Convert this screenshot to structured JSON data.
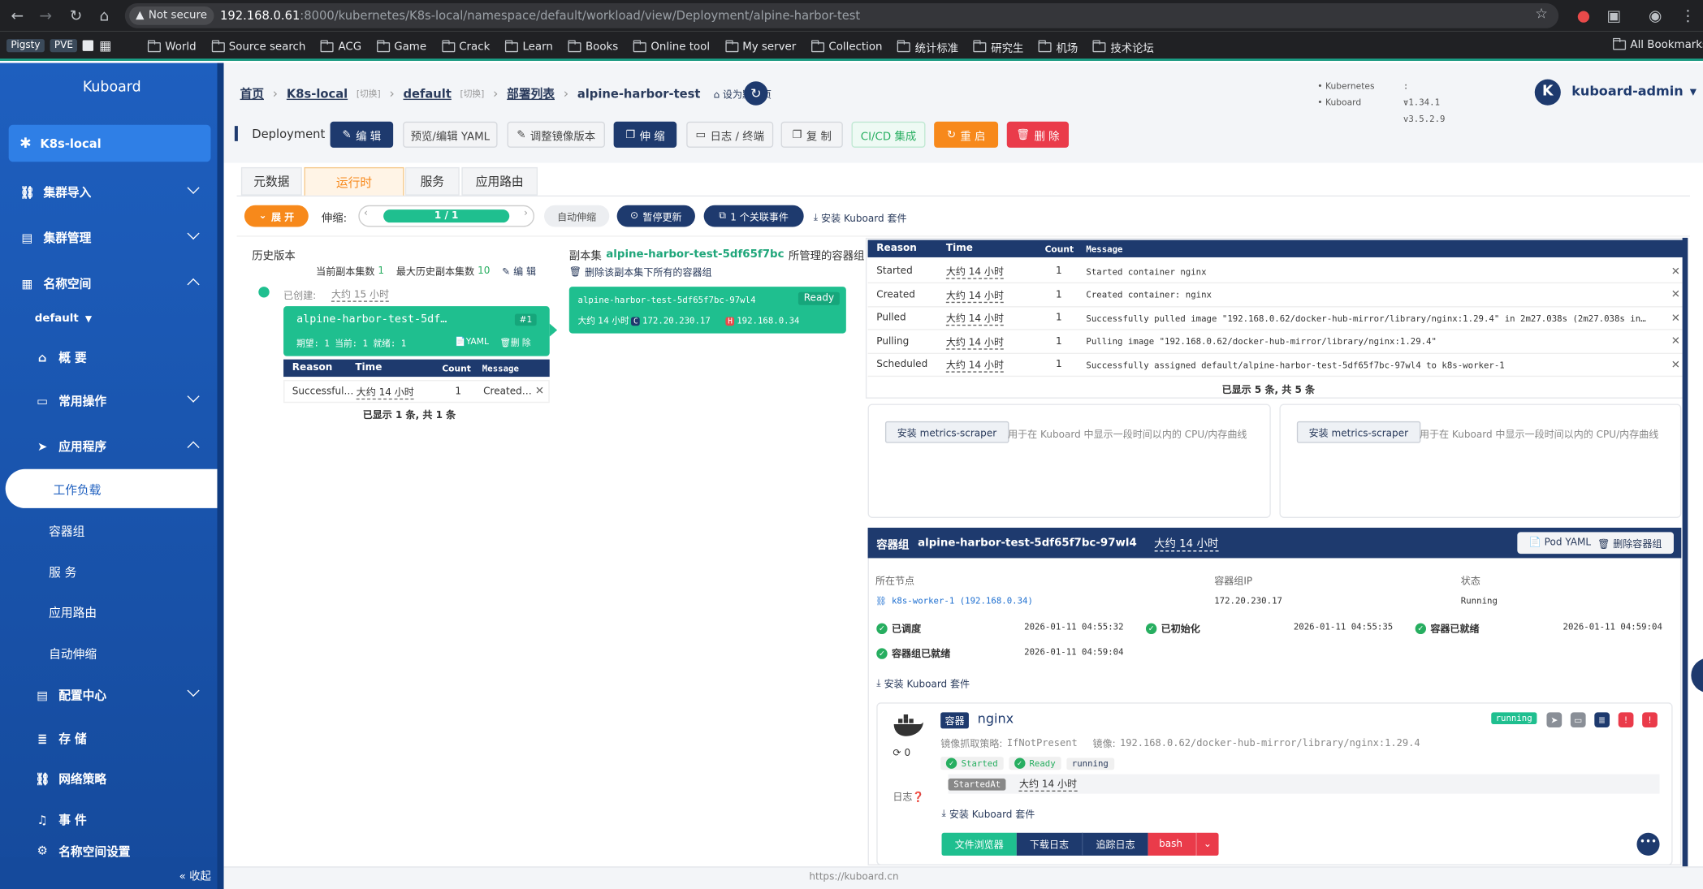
{
  "browser": {
    "not_secure": "Not secure",
    "url_host": "192.168.0.61",
    "url_rest": ":8000/kubernetes/K8s-local/namespace/default/workload/view/Deployment/alpine-harbor-test",
    "bookmarks": [
      "Pigsty",
      "PVE",
      "World",
      "Source search",
      "ACG",
      "Game",
      "Crack",
      "Learn",
      "Books",
      "Online tool",
      "My server",
      "Collection",
      "统计标准",
      "研究生",
      "机场",
      "技术论坛"
    ],
    "all_bookmarks": "All Bookmarks"
  },
  "sidebar": {
    "title": "Kuboard",
    "cluster": "K8s-local",
    "items": {
      "import": "集群导入",
      "manage": "集群管理",
      "namespace": "名称空间",
      "ns_value": "default",
      "overview": "概 要",
      "common": "常用操作",
      "apps": "应用程序",
      "workload": "工作负载",
      "pods": "容器组",
      "services": "服 务",
      "ingress": "应用路由",
      "autoscale": "自动伸缩",
      "config": "配置中心",
      "storage": "存 储",
      "netpol": "网络策略",
      "events": "事 件",
      "ns_settings": "名称空间设置"
    },
    "collapse": "« 收起"
  },
  "header": {
    "crumbs": {
      "home": "首页",
      "cluster": "K8s-local",
      "switch1": "[切换]",
      "ns": "default",
      "switch2": "[切换]",
      "list": "部署列表",
      "name": "alpine-harbor-test",
      "set_default": "设为默认页"
    },
    "versions": {
      "k8s_label": "Kubernetes",
      "k8s_ver": ": v1.34.1",
      "kb_label": "Kuboard",
      "kb_ver": ": v3.5.2.9"
    },
    "user": "kuboard-admin",
    "avatar": "K"
  },
  "toolbar": {
    "kind": "Deployment",
    "edit": "编 辑",
    "yaml": "预览/编辑 YAML",
    "image": "调整镜像版本",
    "scale": "伸 缩",
    "logs": "日志 / 终端",
    "copy": "复 制",
    "cicd": "CI/CD 集成",
    "restart": "重 启",
    "delete": "删 除"
  },
  "tabs": [
    "元数据",
    "运行时",
    "服务",
    "应用路由"
  ],
  "runtime_bar": {
    "expand": "展 开",
    "scale_label": "伸缩:",
    "replicas": "1 / 1",
    "autoscale": "自动伸缩",
    "pause": "暂停更新",
    "events": "1 个关联事件",
    "install": "安装 Kuboard 套件"
  },
  "history": {
    "title": "历史版本",
    "current_label": "当前副本集数",
    "current": "1",
    "max_label": "最大历史副本集数",
    "max": "10",
    "edit": "编 辑",
    "created_label": "已创建:",
    "created_value": "大约 15 小时",
    "rs_name": "alpine-harbor-test-5df…",
    "rs_tag": "#1",
    "rs_desc": "期望: 1 当前: 1 就绪: 1",
    "rs_yaml": "YAML",
    "rs_delete": "删 除",
    "ev_headers": [
      "Reason",
      "Time",
      "Count",
      "Message"
    ],
    "ev_row": {
      "reason": "Successful…",
      "time": "大约 14 小时",
      "count": "1",
      "message": "Created…"
    },
    "ev_footer": "已显示 1 条, 共 1 条"
  },
  "replicaset": {
    "prefix": "副本集",
    "name": "alpine-harbor-test-5df65f7bc",
    "suffix": "所管理的容器组",
    "delete_all": "删除该副本集下所有的容器组",
    "pod_name": "alpine-harbor-test-5df65f7bc-97wl4",
    "pod_status": "Ready",
    "pod_age": "大约 14 小时",
    "pod_c": "C",
    "pod_ip": "172.20.230.17",
    "pod_h": "H",
    "pod_host": "192.168.0.34"
  },
  "events": {
    "headers": [
      "Reason",
      "Time",
      "Count",
      "Message"
    ],
    "rows": [
      {
        "reason": "Started",
        "time": "大约 14 小时",
        "count": "1",
        "message": "Started container nginx"
      },
      {
        "reason": "Created",
        "time": "大约 14 小时",
        "count": "1",
        "message": "Created container: nginx"
      },
      {
        "reason": "Pulled",
        "time": "大约 14 小时",
        "count": "1",
        "message": "Successfully pulled image \"192.168.0.62/docker-hub-mirror/library/nginx:1.29.4\" in 2m27.038s (2m27.038s in…"
      },
      {
        "reason": "Pulling",
        "time": "大约 14 小时",
        "count": "1",
        "message": "Pulling image \"192.168.0.62/docker-hub-mirror/library/nginx:1.29.4\""
      },
      {
        "reason": "Scheduled",
        "time": "大约 14 小时",
        "count": "1",
        "message": "Successfully assigned default/alpine-harbor-test-5df65f7bc-97wl4 to k8s-worker-1"
      }
    ],
    "footer": "已显示 5 条, 共 5 条"
  },
  "metrics": {
    "button": "安装 metrics-scraper",
    "hint": "用于在 Kuboard 中显示一段时间以内的 CPU/内存曲线"
  },
  "pod": {
    "prefix": "容器组",
    "name": "alpine-harbor-test-5df65f7bc-97wl4",
    "age": "大约 14 小时",
    "yaml": "Pod YAML",
    "delete": "删除容器组",
    "node_label": "所在节点",
    "node_value": "k8s-worker-1 (192.168.0.34)",
    "ip_label": "容器组IP",
    "ip_value": "172.20.230.17",
    "status_label": "状态",
    "status_value": "Running",
    "conditions": [
      {
        "label": "已调度",
        "time": "2026-01-11 04:55:32"
      },
      {
        "label": "已初始化",
        "time": "2026-01-11 04:55:35"
      },
      {
        "label": "容器已就绪",
        "time": "2026-01-11 04:59:04"
      },
      {
        "label": "容器组已就绪",
        "time": "2026-01-11 04:59:04"
      }
    ],
    "install": "安装 Kuboard 套件"
  },
  "container": {
    "tag": "容器",
    "name": "nginx",
    "state": "running",
    "pull_label": "镜像抓取策略:",
    "pull_value": "IfNotPresent",
    "image_label": "镜像:",
    "image_value": "192.168.0.62/docker-hub-mirror/library/nginx:1.29.4",
    "restarts": "0",
    "started": "Started",
    "ready": "Ready",
    "running": "running",
    "started_at_label": "StartedAt",
    "started_at": "大约 14 小时",
    "logs_label": "日志",
    "install": "安装 Kuboard 套件",
    "btn_files": "文件浏览器",
    "btn_download": "下载日志",
    "btn_tail": "追踪日志",
    "btn_bash": "bash"
  },
  "footer": {
    "link": "https://kuboard.cn"
  },
  "colors": {
    "primary": "#1e3a6e",
    "accent": "#1fbf8f",
    "orange": "#f7891b",
    "red": "#ea3b4a",
    "sidebar": "#1e5fbf"
  }
}
